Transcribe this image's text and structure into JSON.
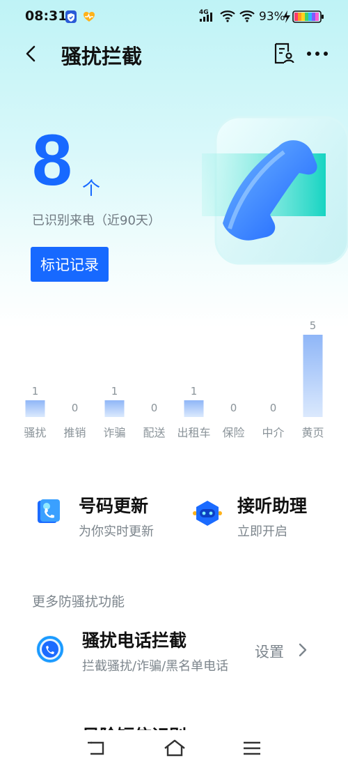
{
  "status_bar": {
    "time": "08:31",
    "network": "4G",
    "battery": "93%"
  },
  "header": {
    "title": "骚扰拦截"
  },
  "hero": {
    "count": "8",
    "unit": "个",
    "subtitle": "已识别来电（近90天）",
    "mark_button": "标记记录"
  },
  "chart_data": {
    "type": "bar",
    "categories": [
      "骚扰",
      "推销",
      "诈骗",
      "配送",
      "出租车",
      "保险",
      "中介",
      "黄页"
    ],
    "values": [
      1,
      0,
      1,
      0,
      1,
      0,
      0,
      5
    ],
    "ylim": [
      0,
      5
    ],
    "bar_color": "#8fb6f7"
  },
  "quick_actions": [
    {
      "title": "号码更新",
      "subtitle": "为你实时更新",
      "icon": "number-update-icon"
    },
    {
      "title": "接听助理",
      "subtitle": "立即开启",
      "icon": "assistant-robot-icon"
    }
  ],
  "more_section": {
    "title": "更多防骚扰功能",
    "items": [
      {
        "title": "骚扰电话拦截",
        "subtitle": "拦截骚扰/诈骗/黑名单电话",
        "action": "设置"
      },
      {
        "title": "风险短信识别"
      }
    ]
  },
  "colors": {
    "accent": "#1769ff"
  }
}
